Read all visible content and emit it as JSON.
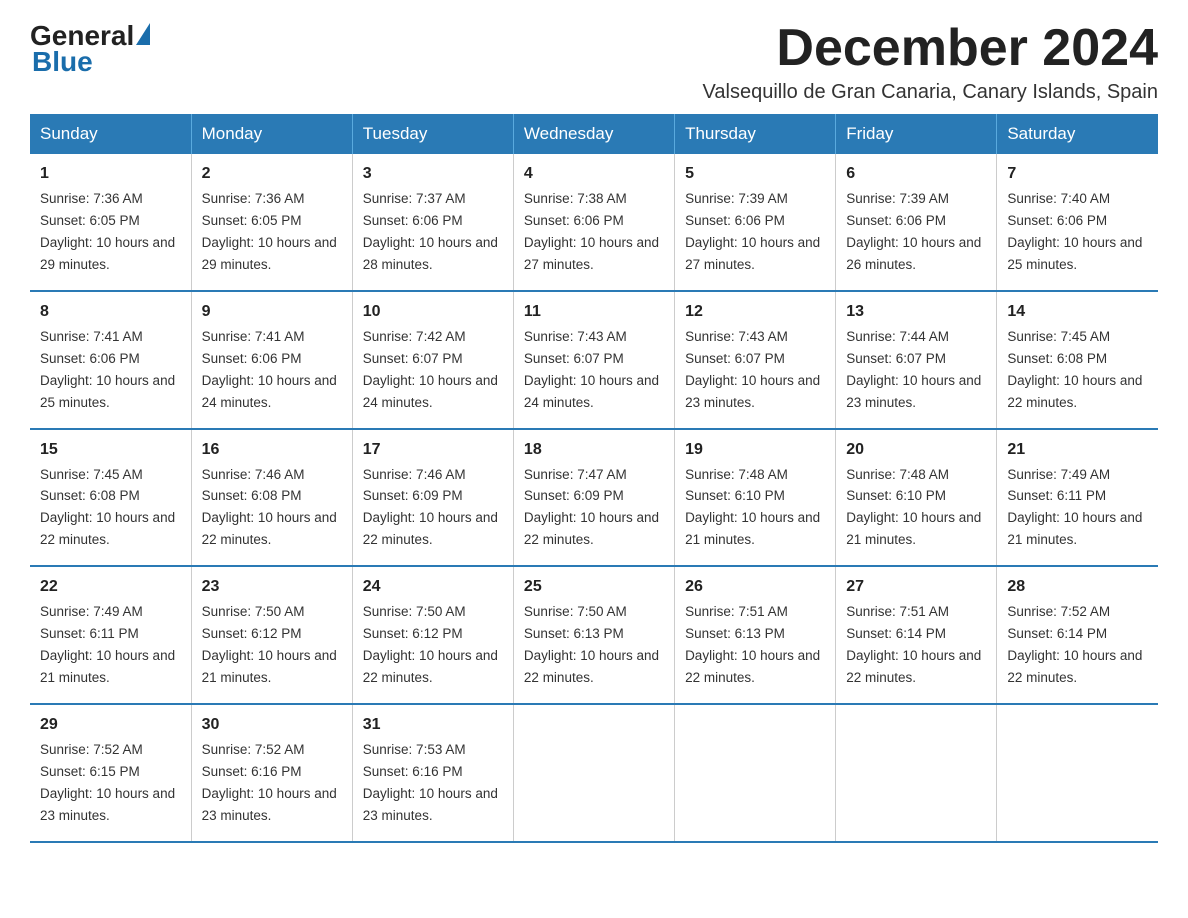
{
  "header": {
    "logo_general": "General",
    "logo_blue": "Blue",
    "month_title": "December 2024",
    "location": "Valsequillo de Gran Canaria, Canary Islands, Spain"
  },
  "days_of_week": [
    "Sunday",
    "Monday",
    "Tuesday",
    "Wednesday",
    "Thursday",
    "Friday",
    "Saturday"
  ],
  "weeks": [
    [
      {
        "day": "1",
        "sunrise": "7:36 AM",
        "sunset": "6:05 PM",
        "daylight": "10 hours and 29 minutes."
      },
      {
        "day": "2",
        "sunrise": "7:36 AM",
        "sunset": "6:05 PM",
        "daylight": "10 hours and 29 minutes."
      },
      {
        "day": "3",
        "sunrise": "7:37 AM",
        "sunset": "6:06 PM",
        "daylight": "10 hours and 28 minutes."
      },
      {
        "day": "4",
        "sunrise": "7:38 AM",
        "sunset": "6:06 PM",
        "daylight": "10 hours and 27 minutes."
      },
      {
        "day": "5",
        "sunrise": "7:39 AM",
        "sunset": "6:06 PM",
        "daylight": "10 hours and 27 minutes."
      },
      {
        "day": "6",
        "sunrise": "7:39 AM",
        "sunset": "6:06 PM",
        "daylight": "10 hours and 26 minutes."
      },
      {
        "day": "7",
        "sunrise": "7:40 AM",
        "sunset": "6:06 PM",
        "daylight": "10 hours and 25 minutes."
      }
    ],
    [
      {
        "day": "8",
        "sunrise": "7:41 AM",
        "sunset": "6:06 PM",
        "daylight": "10 hours and 25 minutes."
      },
      {
        "day": "9",
        "sunrise": "7:41 AM",
        "sunset": "6:06 PM",
        "daylight": "10 hours and 24 minutes."
      },
      {
        "day": "10",
        "sunrise": "7:42 AM",
        "sunset": "6:07 PM",
        "daylight": "10 hours and 24 minutes."
      },
      {
        "day": "11",
        "sunrise": "7:43 AM",
        "sunset": "6:07 PM",
        "daylight": "10 hours and 24 minutes."
      },
      {
        "day": "12",
        "sunrise": "7:43 AM",
        "sunset": "6:07 PM",
        "daylight": "10 hours and 23 minutes."
      },
      {
        "day": "13",
        "sunrise": "7:44 AM",
        "sunset": "6:07 PM",
        "daylight": "10 hours and 23 minutes."
      },
      {
        "day": "14",
        "sunrise": "7:45 AM",
        "sunset": "6:08 PM",
        "daylight": "10 hours and 22 minutes."
      }
    ],
    [
      {
        "day": "15",
        "sunrise": "7:45 AM",
        "sunset": "6:08 PM",
        "daylight": "10 hours and 22 minutes."
      },
      {
        "day": "16",
        "sunrise": "7:46 AM",
        "sunset": "6:08 PM",
        "daylight": "10 hours and 22 minutes."
      },
      {
        "day": "17",
        "sunrise": "7:46 AM",
        "sunset": "6:09 PM",
        "daylight": "10 hours and 22 minutes."
      },
      {
        "day": "18",
        "sunrise": "7:47 AM",
        "sunset": "6:09 PM",
        "daylight": "10 hours and 22 minutes."
      },
      {
        "day": "19",
        "sunrise": "7:48 AM",
        "sunset": "6:10 PM",
        "daylight": "10 hours and 21 minutes."
      },
      {
        "day": "20",
        "sunrise": "7:48 AM",
        "sunset": "6:10 PM",
        "daylight": "10 hours and 21 minutes."
      },
      {
        "day": "21",
        "sunrise": "7:49 AM",
        "sunset": "6:11 PM",
        "daylight": "10 hours and 21 minutes."
      }
    ],
    [
      {
        "day": "22",
        "sunrise": "7:49 AM",
        "sunset": "6:11 PM",
        "daylight": "10 hours and 21 minutes."
      },
      {
        "day": "23",
        "sunrise": "7:50 AM",
        "sunset": "6:12 PM",
        "daylight": "10 hours and 21 minutes."
      },
      {
        "day": "24",
        "sunrise": "7:50 AM",
        "sunset": "6:12 PM",
        "daylight": "10 hours and 22 minutes."
      },
      {
        "day": "25",
        "sunrise": "7:50 AM",
        "sunset": "6:13 PM",
        "daylight": "10 hours and 22 minutes."
      },
      {
        "day": "26",
        "sunrise": "7:51 AM",
        "sunset": "6:13 PM",
        "daylight": "10 hours and 22 minutes."
      },
      {
        "day": "27",
        "sunrise": "7:51 AM",
        "sunset": "6:14 PM",
        "daylight": "10 hours and 22 minutes."
      },
      {
        "day": "28",
        "sunrise": "7:52 AM",
        "sunset": "6:14 PM",
        "daylight": "10 hours and 22 minutes."
      }
    ],
    [
      {
        "day": "29",
        "sunrise": "7:52 AM",
        "sunset": "6:15 PM",
        "daylight": "10 hours and 23 minutes."
      },
      {
        "day": "30",
        "sunrise": "7:52 AM",
        "sunset": "6:16 PM",
        "daylight": "10 hours and 23 minutes."
      },
      {
        "day": "31",
        "sunrise": "7:53 AM",
        "sunset": "6:16 PM",
        "daylight": "10 hours and 23 minutes."
      },
      null,
      null,
      null,
      null
    ]
  ]
}
